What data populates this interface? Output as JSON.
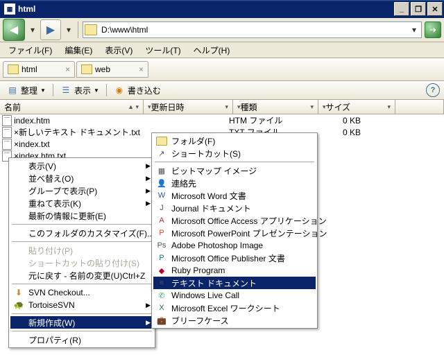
{
  "title": "html",
  "address": "D:\\www\\html",
  "menubar": [
    "ファイル(F)",
    "編集(E)",
    "表示(V)",
    "ツール(T)",
    "ヘルプ(H)"
  ],
  "tabs": [
    {
      "label": "html"
    },
    {
      "label": "web"
    }
  ],
  "toolbar": {
    "organize": "整理",
    "view": "表示",
    "burn": "書き込む"
  },
  "columns": {
    "name": "名前",
    "mdate": "更新日時",
    "type": "種類",
    "size": "サイズ"
  },
  "files": [
    {
      "name": "index.htm",
      "type": "HTM ファイル",
      "size": "0 KB"
    },
    {
      "name": "×新しいテキスト ドキュメント.txt",
      "type": "TXT ファイル",
      "size": "0 KB"
    },
    {
      "name": "×index.txt",
      "type": "",
      "size": ""
    },
    {
      "name": "×index.htm.txt",
      "type": "",
      "size": ""
    }
  ],
  "context_menu": [
    {
      "label": "表示(V)",
      "sub": true
    },
    {
      "label": "並べ替え(O)",
      "sub": true
    },
    {
      "label": "グループで表示(P)",
      "sub": true
    },
    {
      "label": "重ねて表示(K)",
      "sub": true
    },
    {
      "label": "最新の情報に更新(E)"
    },
    {
      "sep": true
    },
    {
      "label": "このフォルダのカスタマイズ(F)..."
    },
    {
      "sep": true
    },
    {
      "label": "貼り付け(P)",
      "dis": true
    },
    {
      "label": "ショートカットの貼り付け(S)",
      "dis": true
    },
    {
      "label": "元に戻す - 名前の変更(U)Ctrl+Z"
    },
    {
      "sep": true
    },
    {
      "label": "SVN Checkout...",
      "icon": "svn"
    },
    {
      "label": "TortoiseSVN",
      "icon": "tortoise",
      "sub": true
    },
    {
      "sep": true
    },
    {
      "label": "新規作成(W)",
      "sub": true,
      "hl": true
    },
    {
      "sep": true
    },
    {
      "label": "プロパティ(R)"
    }
  ],
  "submenu": [
    {
      "label": "フォルダ(F)",
      "icon": "folder"
    },
    {
      "label": "ショートカット(S)",
      "icon": "shortcut"
    },
    {
      "sep": true
    },
    {
      "label": "ビットマップ イメージ",
      "icon": "bmp"
    },
    {
      "label": "連絡先",
      "icon": "contact"
    },
    {
      "label": "Microsoft Word 文書",
      "icon": "word"
    },
    {
      "label": "Journal ドキュメント",
      "icon": "journal"
    },
    {
      "label": "Microsoft Office Access アプリケーション",
      "icon": "access"
    },
    {
      "label": "Microsoft PowerPoint プレゼンテーション",
      "icon": "ppt"
    },
    {
      "label": "Adobe Photoshop Image",
      "icon": "psd"
    },
    {
      "label": "Microsoft Office Publisher 文書",
      "icon": "pub"
    },
    {
      "label": "Ruby Program",
      "icon": "ruby"
    },
    {
      "label": "テキスト ドキュメント",
      "icon": "txt",
      "hl": true
    },
    {
      "label": "Windows Live Call",
      "icon": "wlc"
    },
    {
      "label": "Microsoft Excel ワークシート",
      "icon": "xls"
    },
    {
      "label": "ブリーフケース",
      "icon": "briefcase"
    }
  ]
}
